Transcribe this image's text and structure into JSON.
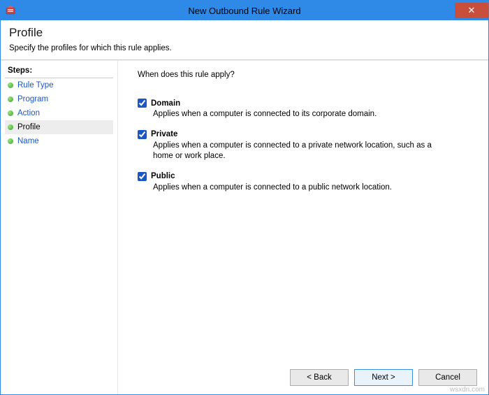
{
  "titlebar": {
    "title": "New Outbound Rule Wizard",
    "close_glyph": "✕"
  },
  "header": {
    "title": "Profile",
    "subtitle": "Specify the profiles for which this rule applies."
  },
  "sidebar": {
    "steps_label": "Steps:",
    "items": [
      {
        "label": "Rule Type",
        "current": false
      },
      {
        "label": "Program",
        "current": false
      },
      {
        "label": "Action",
        "current": false
      },
      {
        "label": "Profile",
        "current": true
      },
      {
        "label": "Name",
        "current": false
      }
    ]
  },
  "content": {
    "question": "When does this rule apply?",
    "options": [
      {
        "label": "Domain",
        "checked": true,
        "desc": "Applies when a computer is connected to its corporate domain."
      },
      {
        "label": "Private",
        "checked": true,
        "desc": "Applies when a computer is connected to a private network location, such as a home or work place."
      },
      {
        "label": "Public",
        "checked": true,
        "desc": "Applies when a computer is connected to a public network location."
      }
    ]
  },
  "footer": {
    "back": "< Back",
    "next": "Next >",
    "cancel": "Cancel"
  },
  "watermark": "wsxdn.com"
}
